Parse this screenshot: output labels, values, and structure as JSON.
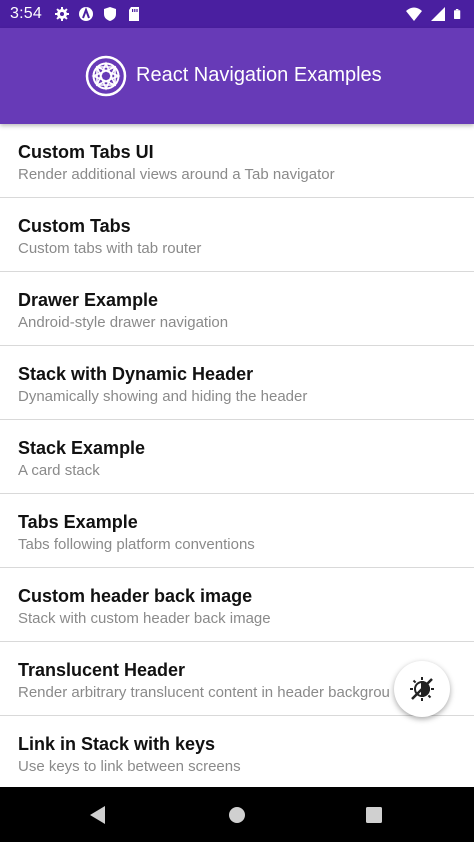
{
  "status_bar": {
    "time": "3:54",
    "left_icons": [
      "gear-icon",
      "a-circle-icon",
      "shield-icon",
      "sd-card-icon"
    ],
    "right_icons": [
      "wifi-icon",
      "cellular-icon",
      "battery-icon"
    ]
  },
  "header": {
    "title": "React Navigation Examples",
    "color": "#673ab7",
    "status_color": "#4a1fa0"
  },
  "list": {
    "items": [
      {
        "title": "Custom Tabs UI",
        "subtitle": "Render additional views around a Tab navigator"
      },
      {
        "title": "Custom Tabs",
        "subtitle": "Custom tabs with tab router"
      },
      {
        "title": "Drawer Example",
        "subtitle": "Android-style drawer navigation"
      },
      {
        "title": "Stack with Dynamic Header",
        "subtitle": "Dynamically showing and hiding the header"
      },
      {
        "title": "Stack Example",
        "subtitle": "A card stack"
      },
      {
        "title": "Tabs Example",
        "subtitle": "Tabs following platform conventions"
      },
      {
        "title": "Custom header back image",
        "subtitle": "Stack with custom header back image"
      },
      {
        "title": "Translucent Header",
        "subtitle": "Render arbitrary translucent content in header backgrou"
      },
      {
        "title": "Link in Stack with keys",
        "subtitle": "Use keys to link between screens"
      }
    ]
  },
  "fab": {
    "icon": "theme-toggle-icon"
  },
  "nav_bar": {
    "icons": [
      "back-icon",
      "home-icon",
      "recents-icon"
    ]
  }
}
